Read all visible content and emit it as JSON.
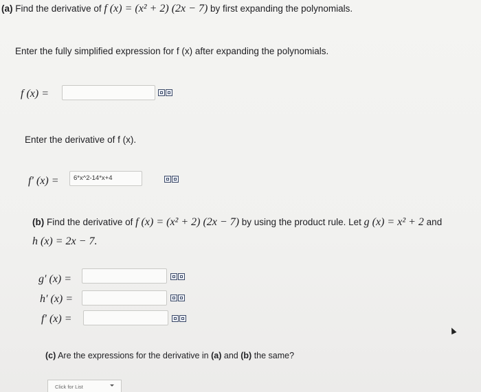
{
  "part_a": {
    "label": "(a)",
    "prompt_start": "Find the derivative of",
    "function_expr": "f (x) = (x² + 2) (2x − 7)",
    "prompt_end": "by first expanding the polynomials.",
    "instruction_expand": "Enter the fully simplified expression for f (x) after expanding the polynomials.",
    "fx_label": "f (x) =",
    "fx_value": "",
    "instruction_derivative": "Enter the derivative of f (x).",
    "fprime_label": "f′ (x) =",
    "fprime_value": "6*x^2-14*x+4"
  },
  "part_b": {
    "label": "(b)",
    "prompt_start": "Find the derivative of",
    "function_expr": "f (x) = (x² + 2) (2x − 7)",
    "prompt_mid": "by using the product rule. Let",
    "g_def": "g (x) = x² + 2",
    "and_word": "and",
    "h_def": "h (x) = 2x − 7.",
    "gprime_label": "g′ (x) =",
    "gprime_value": "",
    "hprime_label": "h′ (x) =",
    "hprime_value": "",
    "fprime_label": "f′ (x) =",
    "fprime_value": ""
  },
  "part_c": {
    "label": "(c)",
    "question_start": "Are the expressions for the derivative in",
    "ref_a": "(a)",
    "and_word": "and",
    "ref_b": "(b)",
    "question_end": "the same?",
    "dropdown_value": "Click for List"
  },
  "icons": [
    "formula-editor-icon",
    "help-icon"
  ]
}
